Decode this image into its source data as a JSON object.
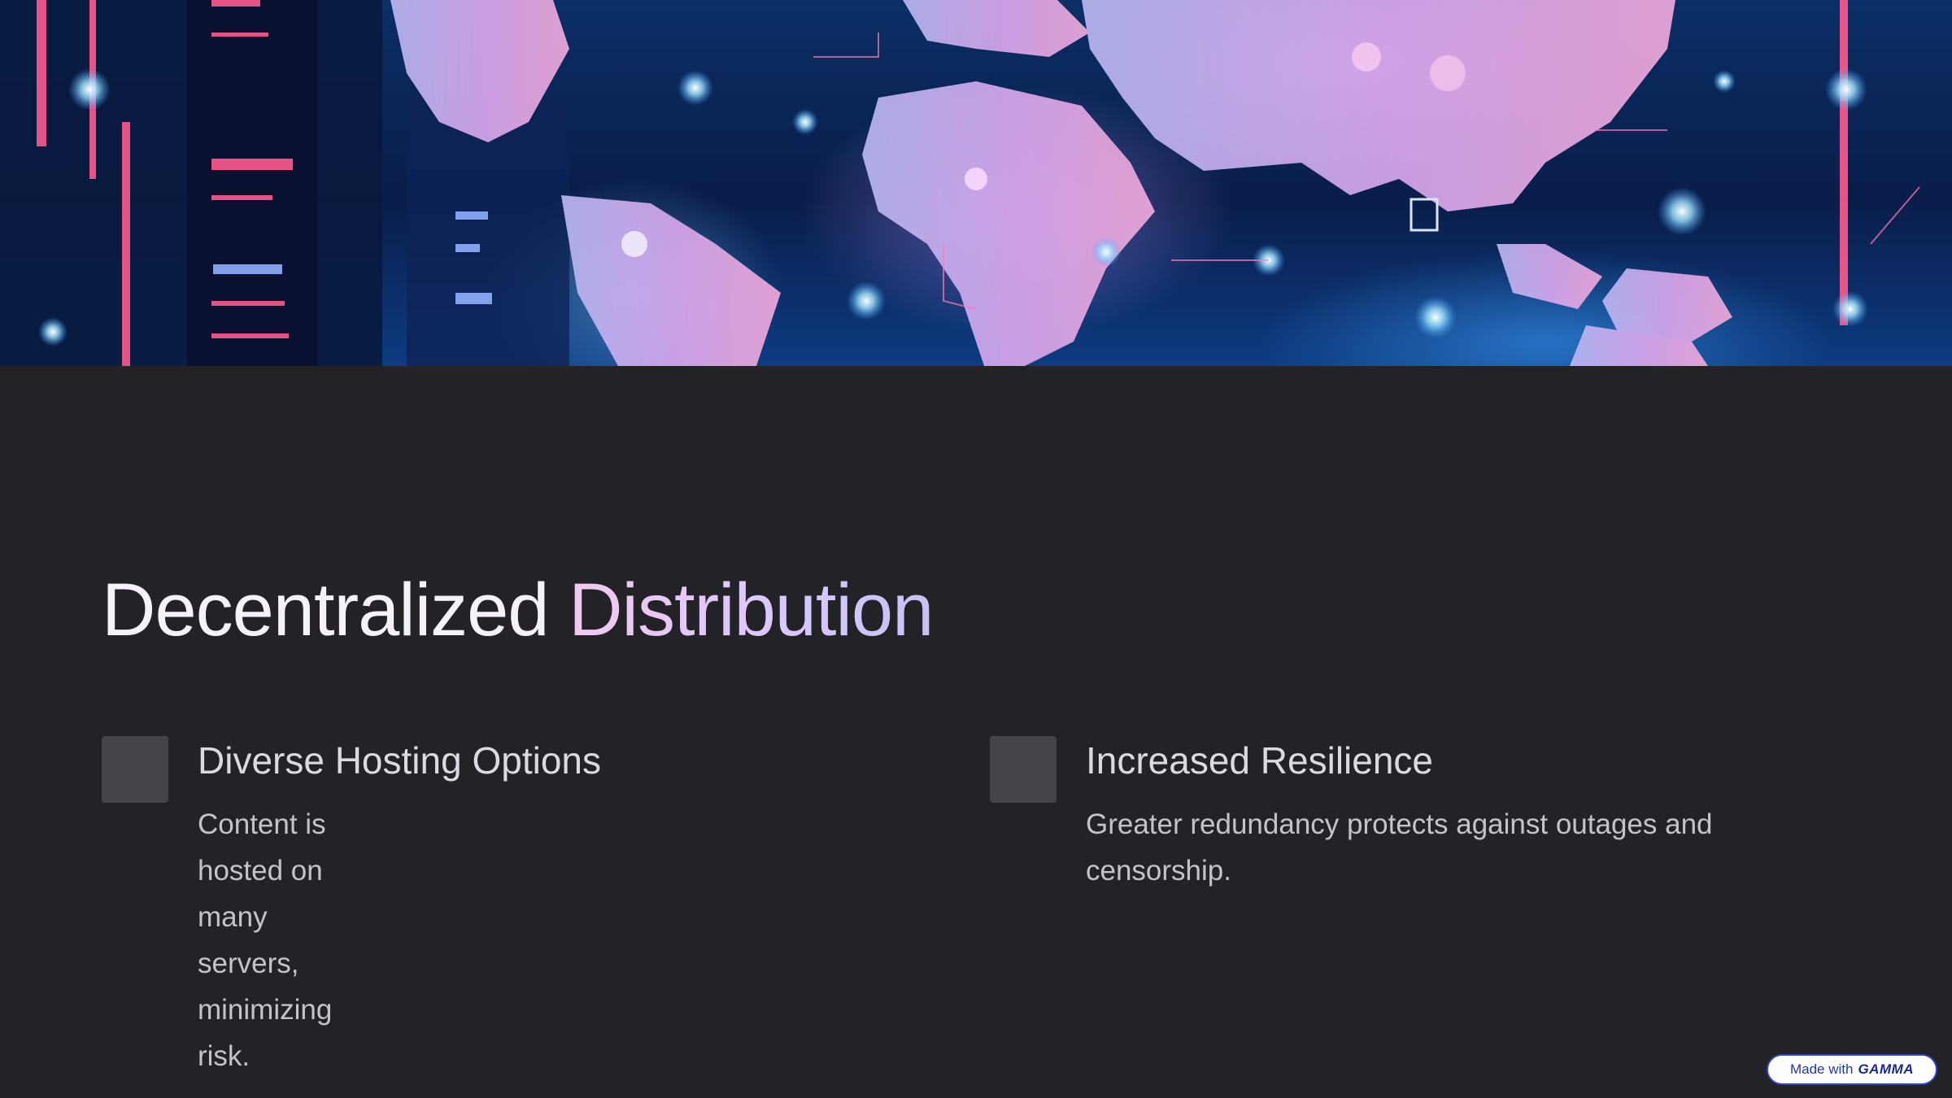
{
  "hero_image": {
    "name": "world-map-network-image",
    "accent_colors": [
      "#ff7fd3",
      "#5fd0ff",
      "#c9a6ff"
    ]
  },
  "slide": {
    "title_word1": "Decentralized",
    "title_word2": "Distribution"
  },
  "features": [
    {
      "title": "Diverse Hosting Options",
      "body": "Content is hosted on many servers, minimizing risk."
    },
    {
      "title": "Increased Resilience",
      "body": "Greater redundancy protects against outages and censorship."
    }
  ],
  "badge": {
    "prefix": "Made with",
    "brand": "GAMMA"
  },
  "colors": {
    "background": "#232227",
    "icon_box": "#454449",
    "title_gradient_start": "#f2c9f0",
    "title_gradient_end": "#c6c2f5"
  }
}
